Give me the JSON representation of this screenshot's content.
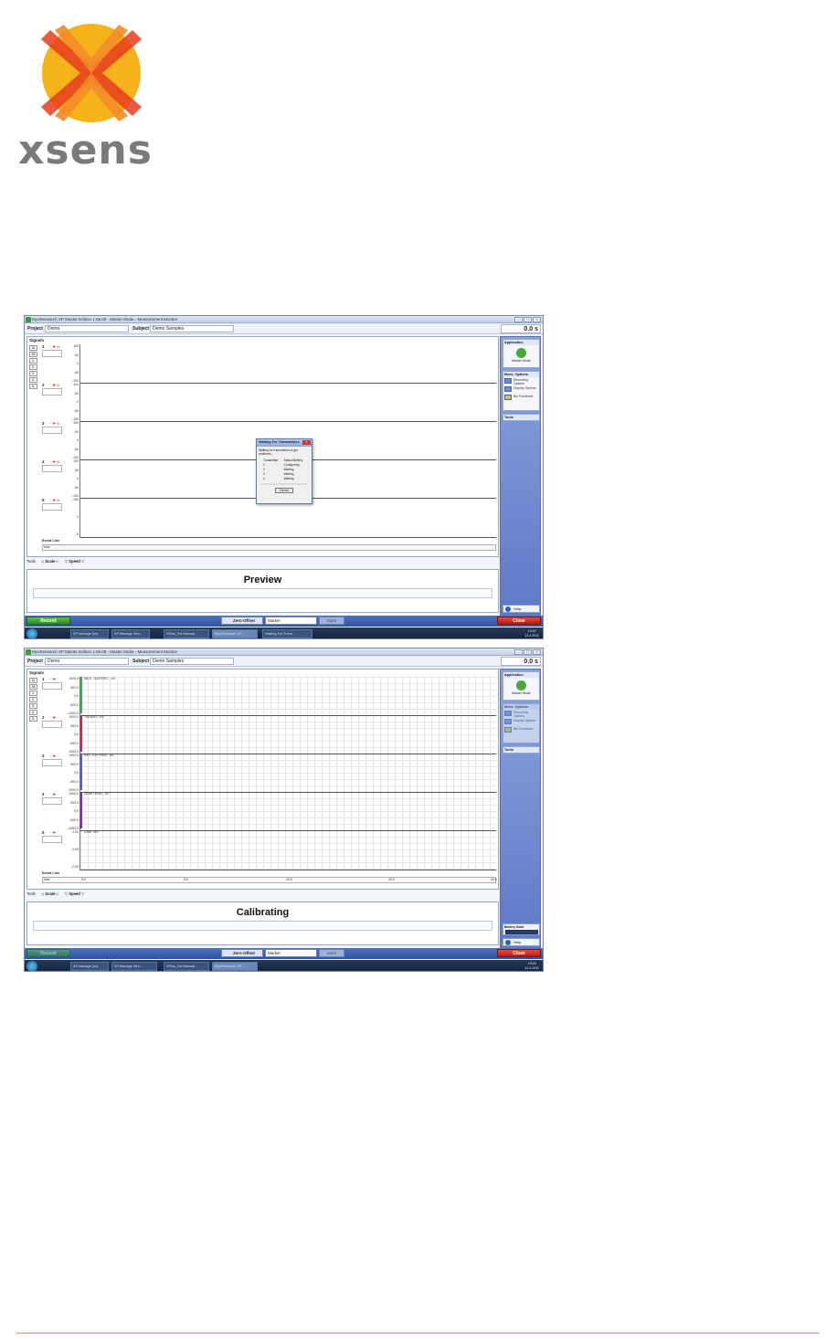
{
  "logo": {
    "text": "xsens",
    "colors": {
      "orange": "#f28c28",
      "red": "#e63c1e",
      "yellow": "#f5b21a"
    }
  },
  "screenshots": [
    {
      "window_title": "MyoResearch XP Master Edition 1.08.08 - Master Mode - Measurement Monitor",
      "project_label": "Project",
      "project_value": "Demo",
      "subject_label": "Subject",
      "subject_value": "Demo Samples",
      "time": "0.0 s",
      "signals_header": "Signals",
      "all_label": "All",
      "leftcol": [
        "1.",
        "2.",
        "3.",
        "4.",
        "5."
      ],
      "channels": [
        "1",
        "2",
        "3",
        "4",
        "5"
      ],
      "ticks": [
        [
          "100",
          "-50",
          "0",
          "-50",
          "-100"
        ],
        [
          "100",
          "-50",
          "0",
          "-50",
          "-100"
        ],
        [
          "100",
          "-50",
          "0",
          "-50",
          "-100"
        ],
        [
          "100",
          "-50",
          "0",
          "-50",
          "-100"
        ],
        [
          "-100",
          "0",
          "-5"
        ]
      ],
      "event_line": "Event Line",
      "time_label": "time",
      "tools_label": "Tools",
      "scale_label": "Scale",
      "speed_label": "Speed",
      "status_text": "Preview",
      "sidebar": {
        "application": "Application",
        "app_item": "Master Mode",
        "meas_options": "Meas. Options",
        "items": [
          "Recording Options",
          "Display Options",
          "Bio Feedback"
        ],
        "tools": "Tools",
        "help": "Help"
      },
      "bottom": {
        "record": "Record",
        "zero_offset": "Zero Offset",
        "marker": "Marker",
        "mark": "Mark",
        "close": "Close"
      },
      "taskbar": [
        "XP Manage (Ini)",
        "XP Manage Wra...",
        "XPlus_Sci Manual...",
        "MyoResearch XP...",
        "Waiting For Trans..."
      ],
      "clock": [
        "13:42",
        "12-4-2011"
      ],
      "dialog": {
        "title": "Waiting For Transmitters",
        "message": "Waiting for transmitters to get realtimes...",
        "col1": "Transmitter",
        "col2": "Status/Battery",
        "rows": [
          [
            "1",
            "Configuring"
          ],
          [
            "2",
            "Waiting"
          ],
          [
            "3",
            "Waiting"
          ],
          [
            "4",
            "Waiting"
          ]
        ],
        "cancel": "Cancel"
      }
    },
    {
      "window_title": "MyoResearch XP Master Edition 1.08.08 - Master Mode - Measurement Monitor",
      "project_label": "Project",
      "project_value": "Demo",
      "subject_label": "Subject",
      "subject_value": "Demo Samples",
      "time": "0.0 s",
      "signals_header": "Signals",
      "all_label": "All",
      "leftcol": [
        "1.",
        "2.",
        "3.",
        "4.",
        "5."
      ],
      "channels": [
        "1",
        "2",
        "3",
        "4",
        "5"
      ],
      "ticks": [
        [
          "1000.0",
          "500.0",
          "0.0",
          "-500.0",
          "-1000.0"
        ],
        [
          "1000.0",
          "500.0",
          "0.0",
          "-500.0",
          "-1000.0"
        ],
        [
          "1000.0",
          "500.0",
          "0.0",
          "-500.0",
          "-1000.0"
        ],
        [
          "1000.0",
          "500.0",
          "0.0",
          "-500.0",
          "-1000.0"
        ],
        [
          "2.00",
          "0.00",
          "-2.00"
        ]
      ],
      "signal_labels": [
        "MEX. GASTRO., uV",
        "TIB ANT., uV",
        "RECTUS FEM., uV",
        "SEMITEND., uV",
        "Goni, mV"
      ],
      "signal_colors": [
        "#3cb44b",
        "#e6194b",
        "#4363d8",
        "#911eb4",
        "#f032e6"
      ],
      "timeline_ticks": [
        "0.0",
        "5.0",
        "10.0",
        "15.0",
        "20.0"
      ],
      "event_line": "Event Line",
      "time_label": "time",
      "tools_label": "Tools",
      "scale_label": "Scale",
      "speed_label": "Speed",
      "status_text": "Calibrating",
      "sidebar": {
        "application": "Application",
        "app_item": "Master Mode",
        "meas_options": "Meas. Options",
        "items": [
          "Recording Options",
          "Display Options",
          "Bio Feedback"
        ],
        "tools": "Tools",
        "battery": "Battery State",
        "help": "Help"
      },
      "bottom": {
        "record": "Record",
        "zero_offset": "Zero Offset",
        "marker": "Marker",
        "mark": "Mark",
        "close": "Close"
      },
      "taskbar": [
        "XP Manage (Ini)",
        "XP Manage Wra...",
        "XPlus_Sci Manual...",
        "MyoResearch XP..."
      ],
      "clock": [
        "13:43",
        "12-4-2011"
      ]
    }
  ]
}
